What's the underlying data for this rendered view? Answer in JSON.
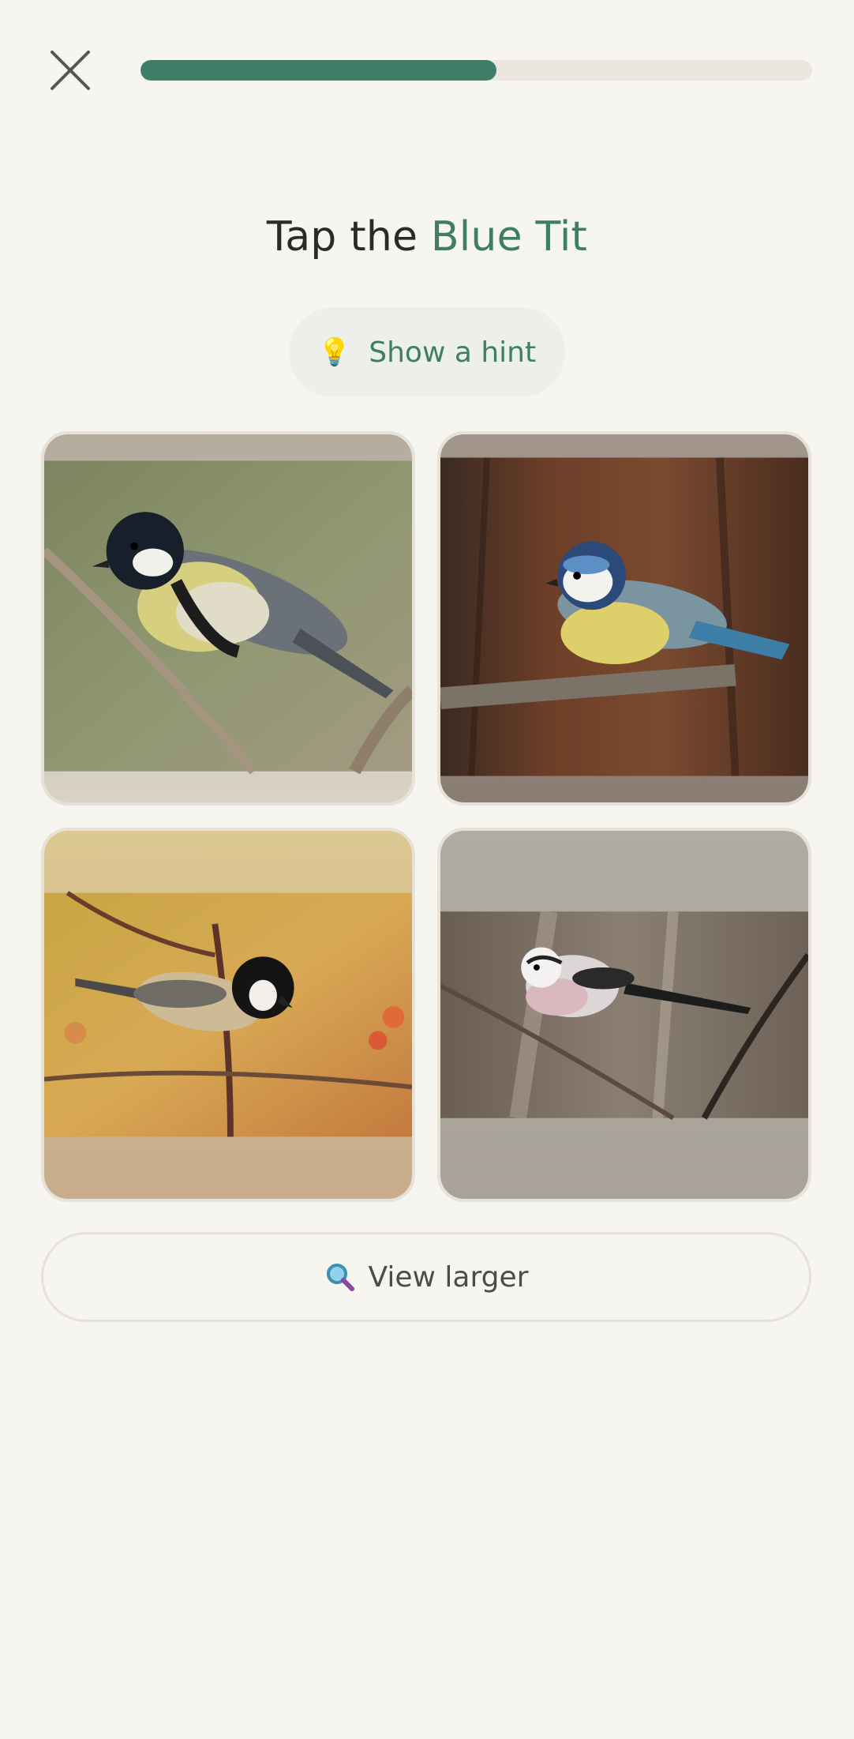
{
  "header": {
    "close_icon": "close-icon",
    "progress": 0.53
  },
  "prompt": {
    "prefix": "Tap the",
    "target": "Blue Tit"
  },
  "hint": {
    "icon": "lightbulb-icon",
    "label": "Show a hint"
  },
  "choices": [
    {
      "id": "great-tit"
    },
    {
      "id": "blue-tit"
    },
    {
      "id": "coal-tit"
    },
    {
      "id": "long-tailed-tit"
    }
  ],
  "view_larger": {
    "icon": "magnifier-icon",
    "label": "View larger"
  },
  "colors": {
    "accent": "#3f7d68",
    "background": "#f6f5f0",
    "track": "#ebe7df"
  }
}
